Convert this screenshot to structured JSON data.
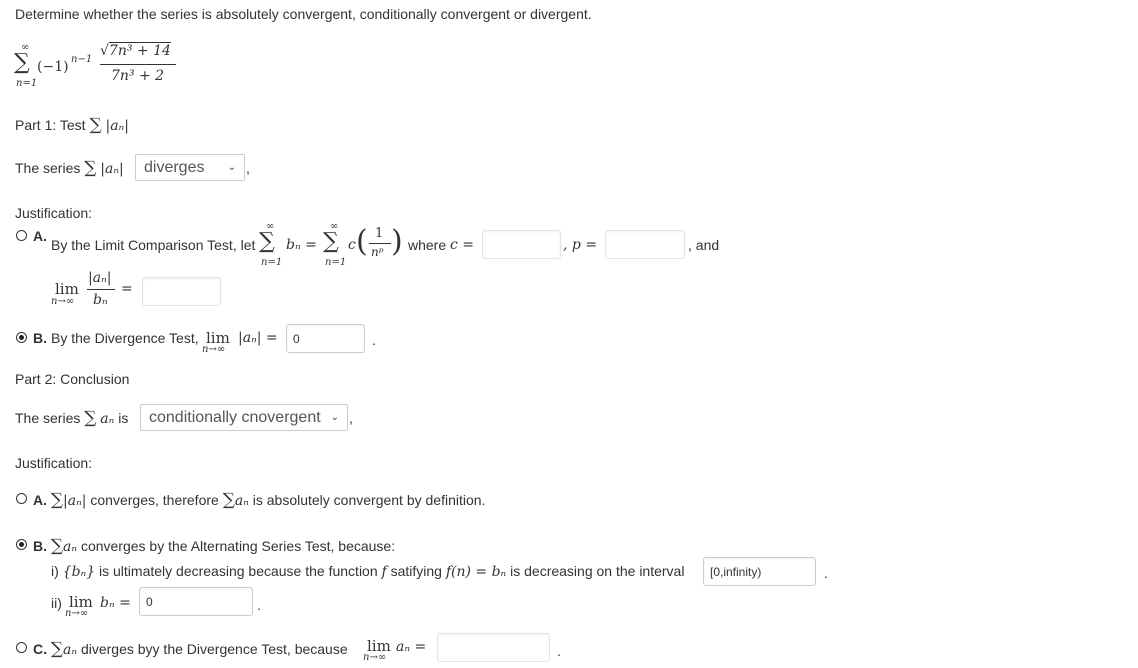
{
  "problem": {
    "prompt": "Determine whether the series is absolutely convergent, conditionally convergent or divergent.",
    "series_sum_top": "∞",
    "series_sum_bottom": "n=1",
    "series_sign_term": "(−1)",
    "series_sign_exp": "n−1",
    "series_numerator": "7n³ + 14",
    "series_denominator": "7n³ + 2"
  },
  "part1": {
    "heading": "Part 1: Test",
    "heading_expr": "|aₙ|",
    "series_label": "The series",
    "series_expr": "|aₙ|",
    "select_value": "diverges",
    "trailing": ",",
    "justification_label": "Justification:",
    "option_a": {
      "letter": "A.",
      "text_before": "By the Limit Comparison Test, let",
      "sum_top": "∞",
      "sum_bottom": "n=1",
      "bn_term": "bₙ =",
      "c_term": "c",
      "frac_num": "1",
      "frac_den": "nᵖ",
      "where_text": "where",
      "c_eq": "c =",
      "c_value": "",
      "p_eq": ", p =",
      "p_value": "",
      "and_text": ", and",
      "lim_word": "lim",
      "lim_sub": "n→∞",
      "ratio_num": "|aₙ|",
      "ratio_den": "bₙ",
      "ratio_eq": "=",
      "ratio_value": "",
      "selected": false
    },
    "option_b": {
      "letter": "B.",
      "text": "By the Divergence Test,",
      "lim_word": "lim",
      "lim_sub": "n→∞",
      "expr": "|aₙ| =",
      "value": "0",
      "trailing": ".",
      "selected": true
    }
  },
  "part2": {
    "heading": "Part 2: Conclusion",
    "series_label": "The series",
    "series_expr": "aₙ",
    "is_text": "is",
    "select_value": "conditionally cnovergent",
    "trailing": ",",
    "justification_label": "Justification:",
    "option_a": {
      "letter": "A.",
      "expr1": "|aₙ|",
      "text1": "converges, therefore",
      "expr2": "aₙ",
      "text2": "is absolutely convergent by definition.",
      "selected": false
    },
    "option_b": {
      "letter": "B.",
      "expr": "aₙ",
      "text": "converges by the Alternating Series Test, because:",
      "item_i_prefix": "i)",
      "item_i_set": "{bₙ}",
      "item_i_text1": "is ultimately decreasing because the function",
      "item_i_f": "f",
      "item_i_text2": "satifying",
      "item_i_eq": "f(n) = bₙ",
      "item_i_text3": "is decreasing on the interval",
      "item_i_value": "[0,infinity)",
      "item_i_trailing": ".",
      "item_ii_prefix": "ii)",
      "item_ii_lim": "lim",
      "item_ii_sub": "n→∞",
      "item_ii_expr": "bₙ =",
      "item_ii_value": "0",
      "item_ii_trailing": ".",
      "selected": true
    },
    "option_c": {
      "letter": "C.",
      "expr": "aₙ",
      "text": "diverges byy the Divergence Test, because",
      "lim_word": "lim",
      "lim_sub": "n→∞",
      "lim_expr": "aₙ =",
      "value": "",
      "trailing": ".",
      "selected": false
    }
  }
}
